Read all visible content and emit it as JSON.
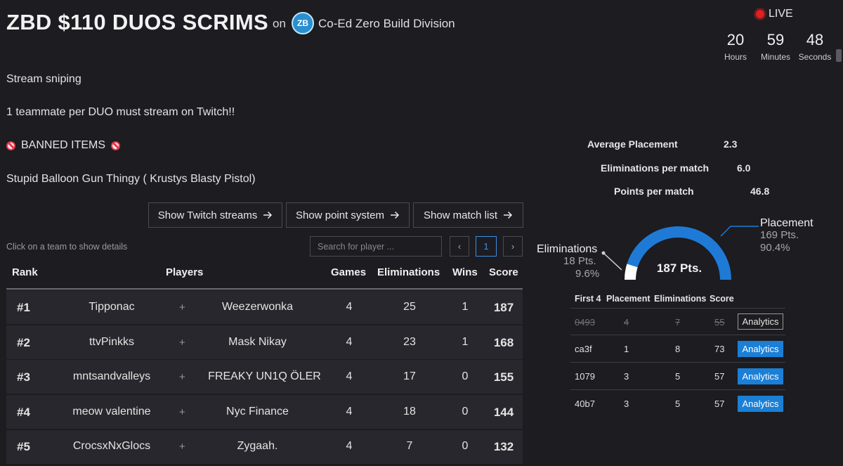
{
  "header": {
    "title": "ZBD $110 DUOS SCRIMS",
    "on": "on",
    "org_logo_text": "ZB",
    "org_name": "Co-Ed Zero Build Division",
    "live": "LIVE",
    "countdown": [
      {
        "value": "20",
        "label": "Hours"
      },
      {
        "value": "59",
        "label": "Minutes"
      },
      {
        "value": "48",
        "label": "Seconds"
      }
    ]
  },
  "description": {
    "line1": "Stream sniping",
    "line2": "1 teammate per DUO must stream on Twitch!!",
    "banned_heading": "BANNED ITEMS",
    "banned_item": "Stupid Balloon Gun Thingy ( Krustys Blasty Pistol)"
  },
  "buttons": {
    "twitch": "Show Twitch streams",
    "points": "Show point system",
    "matches": "Show match list"
  },
  "hint": "Click on a team to show details",
  "search": {
    "placeholder": "Search for player ..."
  },
  "pagination": {
    "prev": "‹",
    "current": "1",
    "next": "›"
  },
  "table": {
    "headers": {
      "rank": "Rank",
      "players": "Players",
      "games": "Games",
      "eliminations": "Eliminations",
      "wins": "Wins",
      "score": "Score"
    },
    "rows": [
      {
        "rank": "#1",
        "p1": "Tipponac",
        "plus": "+",
        "p2": "Weezerwonka",
        "games": "4",
        "elims": "25",
        "wins": "1",
        "score": "187"
      },
      {
        "rank": "#2",
        "p1": "ttvPinkks",
        "plus": "+",
        "p2": "Mask Nikay",
        "games": "4",
        "elims": "23",
        "wins": "1",
        "score": "168"
      },
      {
        "rank": "#3",
        "p1": "mntsandvalleys",
        "plus": "+",
        "p2": "FREAKY UN1Q ÖLER",
        "games": "4",
        "elims": "17",
        "wins": "0",
        "score": "155"
      },
      {
        "rank": "#4",
        "p1": "meow valentine",
        "plus": "+",
        "p2": "Nyc Finance",
        "games": "4",
        "elims": "18",
        "wins": "0",
        "score": "144"
      },
      {
        "rank": "#5",
        "p1": "CrocsxNxGlocs",
        "plus": "+",
        "p2": "Zygaah.",
        "games": "4",
        "elims": "7",
        "wins": "0",
        "score": "132"
      }
    ]
  },
  "stats": {
    "avg_placement_label": "Average Placement",
    "avg_placement": "2.3",
    "elims_label": "Eliminations per match",
    "elims": "6.0",
    "ppm_label": "Points per match",
    "ppm": "46.8"
  },
  "gauge": {
    "total": "187 Pts.",
    "elims": {
      "label": "Eliminations",
      "pts": "18 Pts.",
      "pct": "9.6%",
      "fraction": 0.096
    },
    "placement": {
      "label": "Placement",
      "pts": "169 Pts.",
      "pct": "90.4%",
      "fraction": 0.904
    },
    "colors": {
      "placement": "#1f7ad6",
      "elims": "#ffffff"
    }
  },
  "matches": {
    "headers": {
      "first4": "First 4",
      "placement": "Placement",
      "eliminations": "Eliminations",
      "score": "Score"
    },
    "rows": [
      {
        "id": "0493",
        "placement": "4",
        "elims": "7",
        "score": "55",
        "button": "Analytics",
        "struck": true
      },
      {
        "id": "ca3f",
        "placement": "1",
        "elims": "8",
        "score": "73",
        "button": "Analytics",
        "struck": false
      },
      {
        "id": "1079",
        "placement": "3",
        "elims": "5",
        "score": "57",
        "button": "Analytics",
        "struck": false
      },
      {
        "id": "40b7",
        "placement": "3",
        "elims": "5",
        "score": "57",
        "button": "Analytics",
        "struck": false
      }
    ]
  }
}
